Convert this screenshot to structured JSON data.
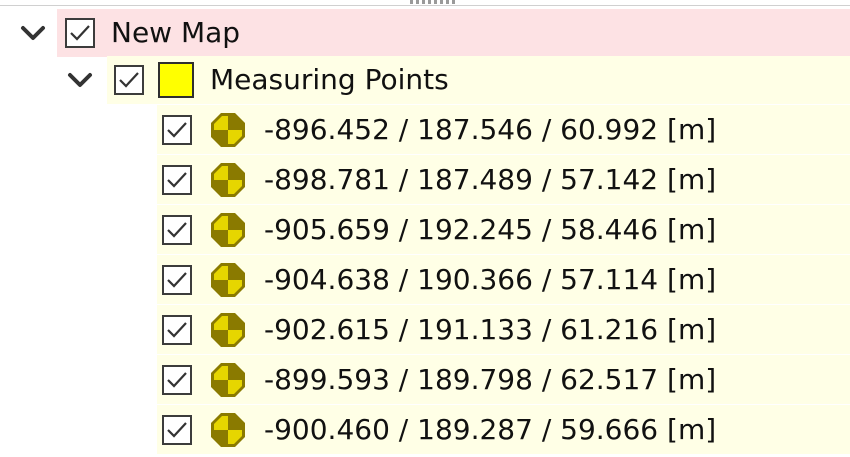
{
  "root": {
    "label": "New Map",
    "checked": true,
    "expanded": true,
    "highlight_color": "#fde2e4"
  },
  "layer": {
    "label": "Measuring Points",
    "checked": true,
    "expanded": true,
    "icon": "yellow-square-icon",
    "icon_color": "#ffff00",
    "row_color": "#ffffe6"
  },
  "points": [
    {
      "label": "-896.452 / 187.546 / 60.992 [m]",
      "checked": true,
      "icon": "measuring-point-icon"
    },
    {
      "label": "-898.781 / 187.489 / 57.142 [m]",
      "checked": true,
      "icon": "measuring-point-icon"
    },
    {
      "label": "-905.659 / 192.245 / 58.446 [m]",
      "checked": true,
      "icon": "measuring-point-icon"
    },
    {
      "label": "-904.638 / 190.366 / 57.114 [m]",
      "checked": true,
      "icon": "measuring-point-icon"
    },
    {
      "label": "-902.615 / 191.133 / 61.216 [m]",
      "checked": true,
      "icon": "measuring-point-icon"
    },
    {
      "label": "-899.593 / 189.798 / 62.517 [m]",
      "checked": true,
      "icon": "measuring-point-icon"
    },
    {
      "label": "-900.460 / 189.287 / 59.666 [m]",
      "checked": true,
      "icon": "measuring-point-icon"
    }
  ],
  "colors": {
    "point_fill": "#e6d600",
    "point_dark": "#8a7a00"
  }
}
